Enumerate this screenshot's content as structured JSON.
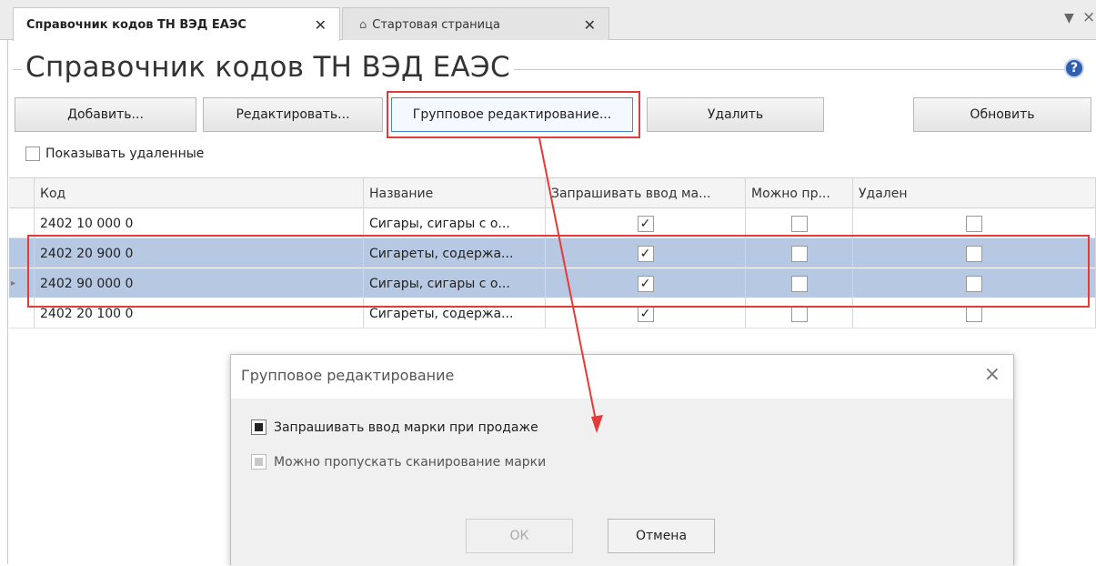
{
  "tabs": [
    {
      "label": "Справочник кодов ТН ВЭД ЕАЭС",
      "close": "✕"
    },
    {
      "label": "Стартовая страница",
      "close": "✕",
      "icon": "home-icon"
    }
  ],
  "strip_controls": {
    "dropdown": "▼",
    "close": "×"
  },
  "page": {
    "title": "Справочник кодов ТН ВЭД ЕАЭС",
    "help": "?"
  },
  "toolbar": {
    "add": "Добавить...",
    "edit": "Редактировать...",
    "group_edit": "Групповое редактирование...",
    "delete": "Удалить",
    "refresh": "Обновить"
  },
  "show_deleted": {
    "label": "Показывать удаленные",
    "checked": false
  },
  "grid": {
    "columns": [
      "Код",
      "Название",
      "Запрашивать ввод ма...",
      "Можно пр...",
      "Удален"
    ],
    "rows": [
      {
        "code": "2402 10 000 0",
        "name": "Сигары, сигары с о...",
        "ask_mark": true,
        "skip_scan": false,
        "deleted": false,
        "selected": false
      },
      {
        "code": "2402 20 900 0",
        "name": "Сигареты, содержа...",
        "ask_mark": true,
        "skip_scan": false,
        "deleted": false,
        "selected": true
      },
      {
        "code": "2402 90 000 0",
        "name": "Сигары, сигары с о...",
        "ask_mark": true,
        "skip_scan": false,
        "deleted": false,
        "selected": true
      },
      {
        "code": "2402 20 100 0",
        "name": "Сигареты, содержа...",
        "ask_mark": true,
        "skip_scan": false,
        "deleted": false,
        "selected": false
      }
    ]
  },
  "dialog": {
    "title": "Групповое редактирование",
    "close": "×",
    "options": [
      {
        "label": "Запрашивать ввод марки при продаже",
        "state": "indeterminate",
        "enabled": true
      },
      {
        "label": "Можно пропускать сканирование марки",
        "state": "indeterminate",
        "enabled": false
      }
    ],
    "ok": "ОК",
    "cancel": "Отмена"
  },
  "colors": {
    "annotation": "#e53a3a",
    "selection": "#b6c8e2",
    "help": "#2f5fae",
    "focus": "#4b86d6"
  }
}
